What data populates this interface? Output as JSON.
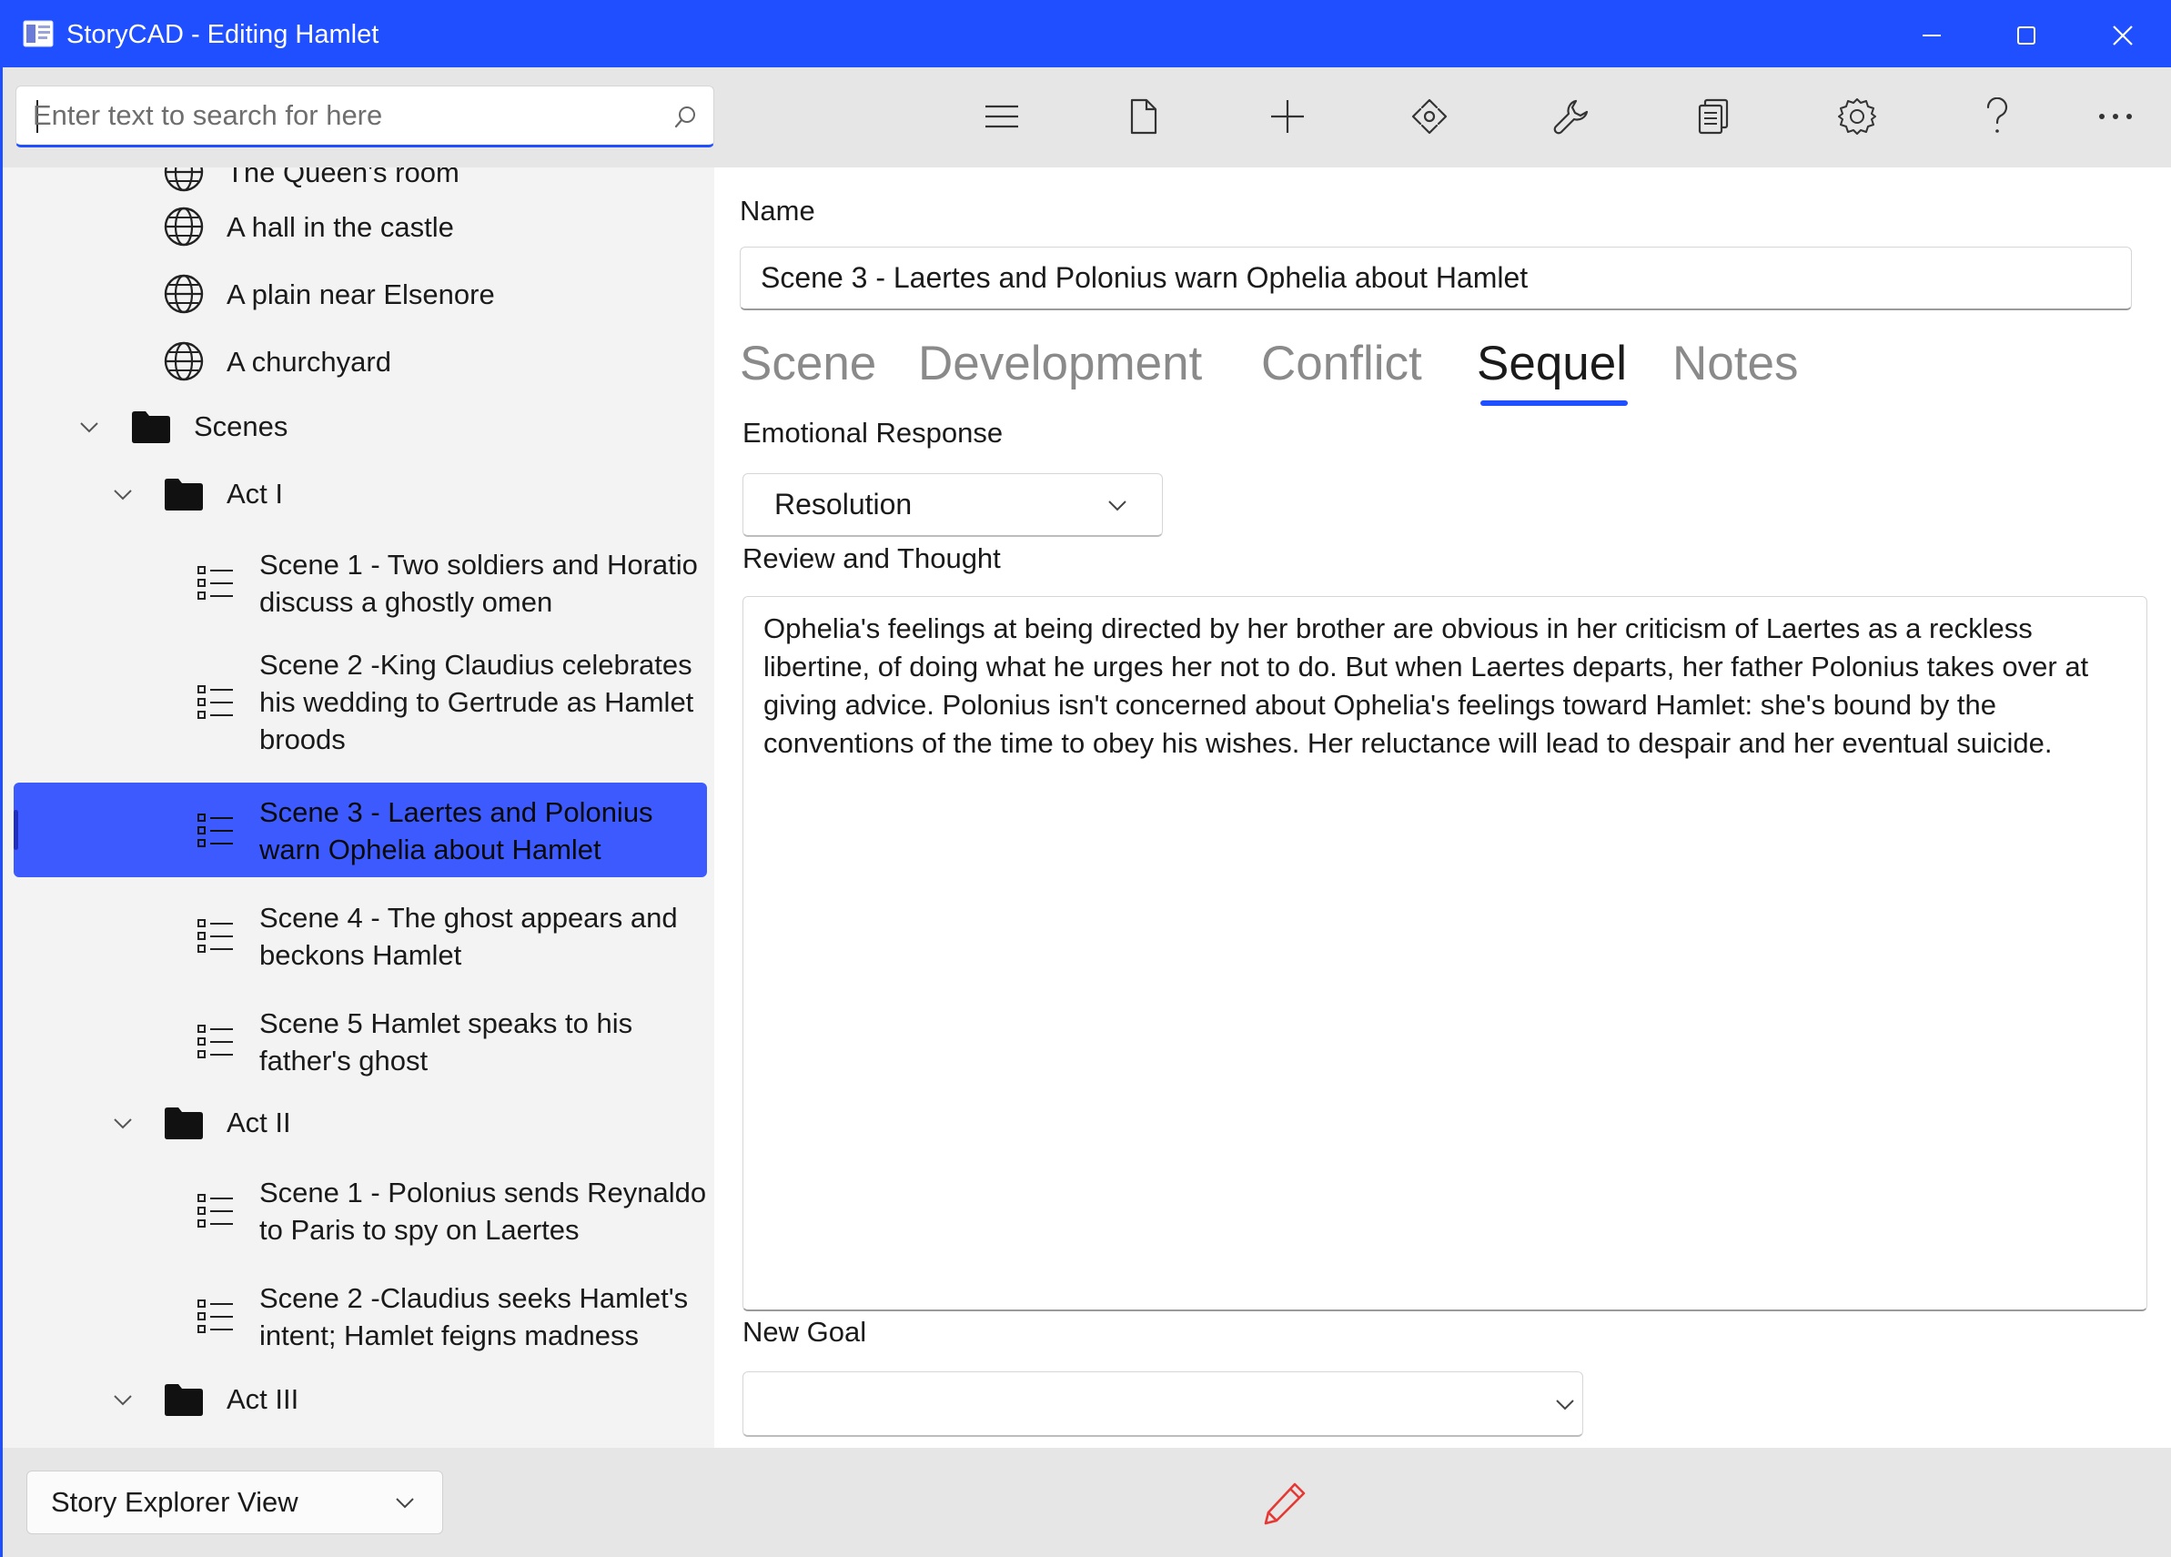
{
  "window": {
    "title": "StoryCAD - Editing Hamlet",
    "accent_color": "#1f4fff"
  },
  "search": {
    "placeholder": "Enter text to search for here",
    "value": ""
  },
  "toolbar": {
    "buttons": [
      {
        "icon": "hamburger-menu-icon"
      },
      {
        "icon": "new-file-icon"
      },
      {
        "icon": "add-icon"
      },
      {
        "icon": "move-arrows-icon"
      },
      {
        "icon": "wrench-icon"
      },
      {
        "icon": "reports-icon"
      },
      {
        "icon": "gear-icon"
      },
      {
        "icon": "help-icon"
      },
      {
        "icon": "more-icon"
      }
    ]
  },
  "tree": {
    "partial_label": "The Queen's room",
    "settings": [
      "A hall in the castle",
      "A plain near Elsenore",
      "A churchyard"
    ],
    "scenes_folder": "Scenes",
    "act1": {
      "label": "Act I",
      "scenes": [
        {
          "line1": "Scene 1 - Two soldiers and Horatio",
          "line2": "discuss a ghostly omen"
        },
        {
          "line1": "Scene 2 -King Claudius celebrates",
          "line2": "his wedding to Gertrude as Hamlet",
          "line3": "broods"
        },
        {
          "line1": "Scene 3 - Laertes and Polonius",
          "line2": "warn Ophelia about Hamlet",
          "selected": true
        },
        {
          "line1": "Scene 4 - The ghost appears and",
          "line2": "beckons Hamlet"
        },
        {
          "line1": "Scene 5 Hamlet speaks to his",
          "line2": "father's ghost"
        }
      ]
    },
    "act2": {
      "label": "Act II",
      "scenes": [
        {
          "line1": "Scene 1 - Polonius sends Reynaldo",
          "line2": "to Paris to spy on Laertes"
        },
        {
          "line1": "Scene 2 -Claudius seeks Hamlet's",
          "line2": "intent; Hamlet feigns madness"
        }
      ]
    },
    "act3": {
      "label": "Act III"
    }
  },
  "content": {
    "name_label": "Name",
    "name_value": "Scene 3 - Laertes and Polonius warn Ophelia about Hamlet",
    "tabs": [
      "Scene",
      "Development",
      "Conflict",
      "Sequel",
      "Notes"
    ],
    "active_tab": "Sequel",
    "emotional_response_label": "Emotional Response",
    "emotional_response_value": "Resolution",
    "review_label": "Review and Thought",
    "review_text": "Ophelia's feelings at being directed by her brother are obvious in her criticism of Laertes as a reckless libertine, of doing what he urges her not to do. But when Laertes departs, her father Polonius takes over at giving advice. Polonius isn't concerned about Ophelia's feelings toward Hamlet: she's bound by the conventions of the time to obey his wishes. Her reluctance will lead to despair and her eventual suicide.",
    "new_goal_label": "New Goal",
    "new_goal_value": ""
  },
  "statusbar": {
    "view_value": "Story Explorer View",
    "edit_icon": "pencil-icon",
    "edit_icon_color": "#e53935"
  }
}
